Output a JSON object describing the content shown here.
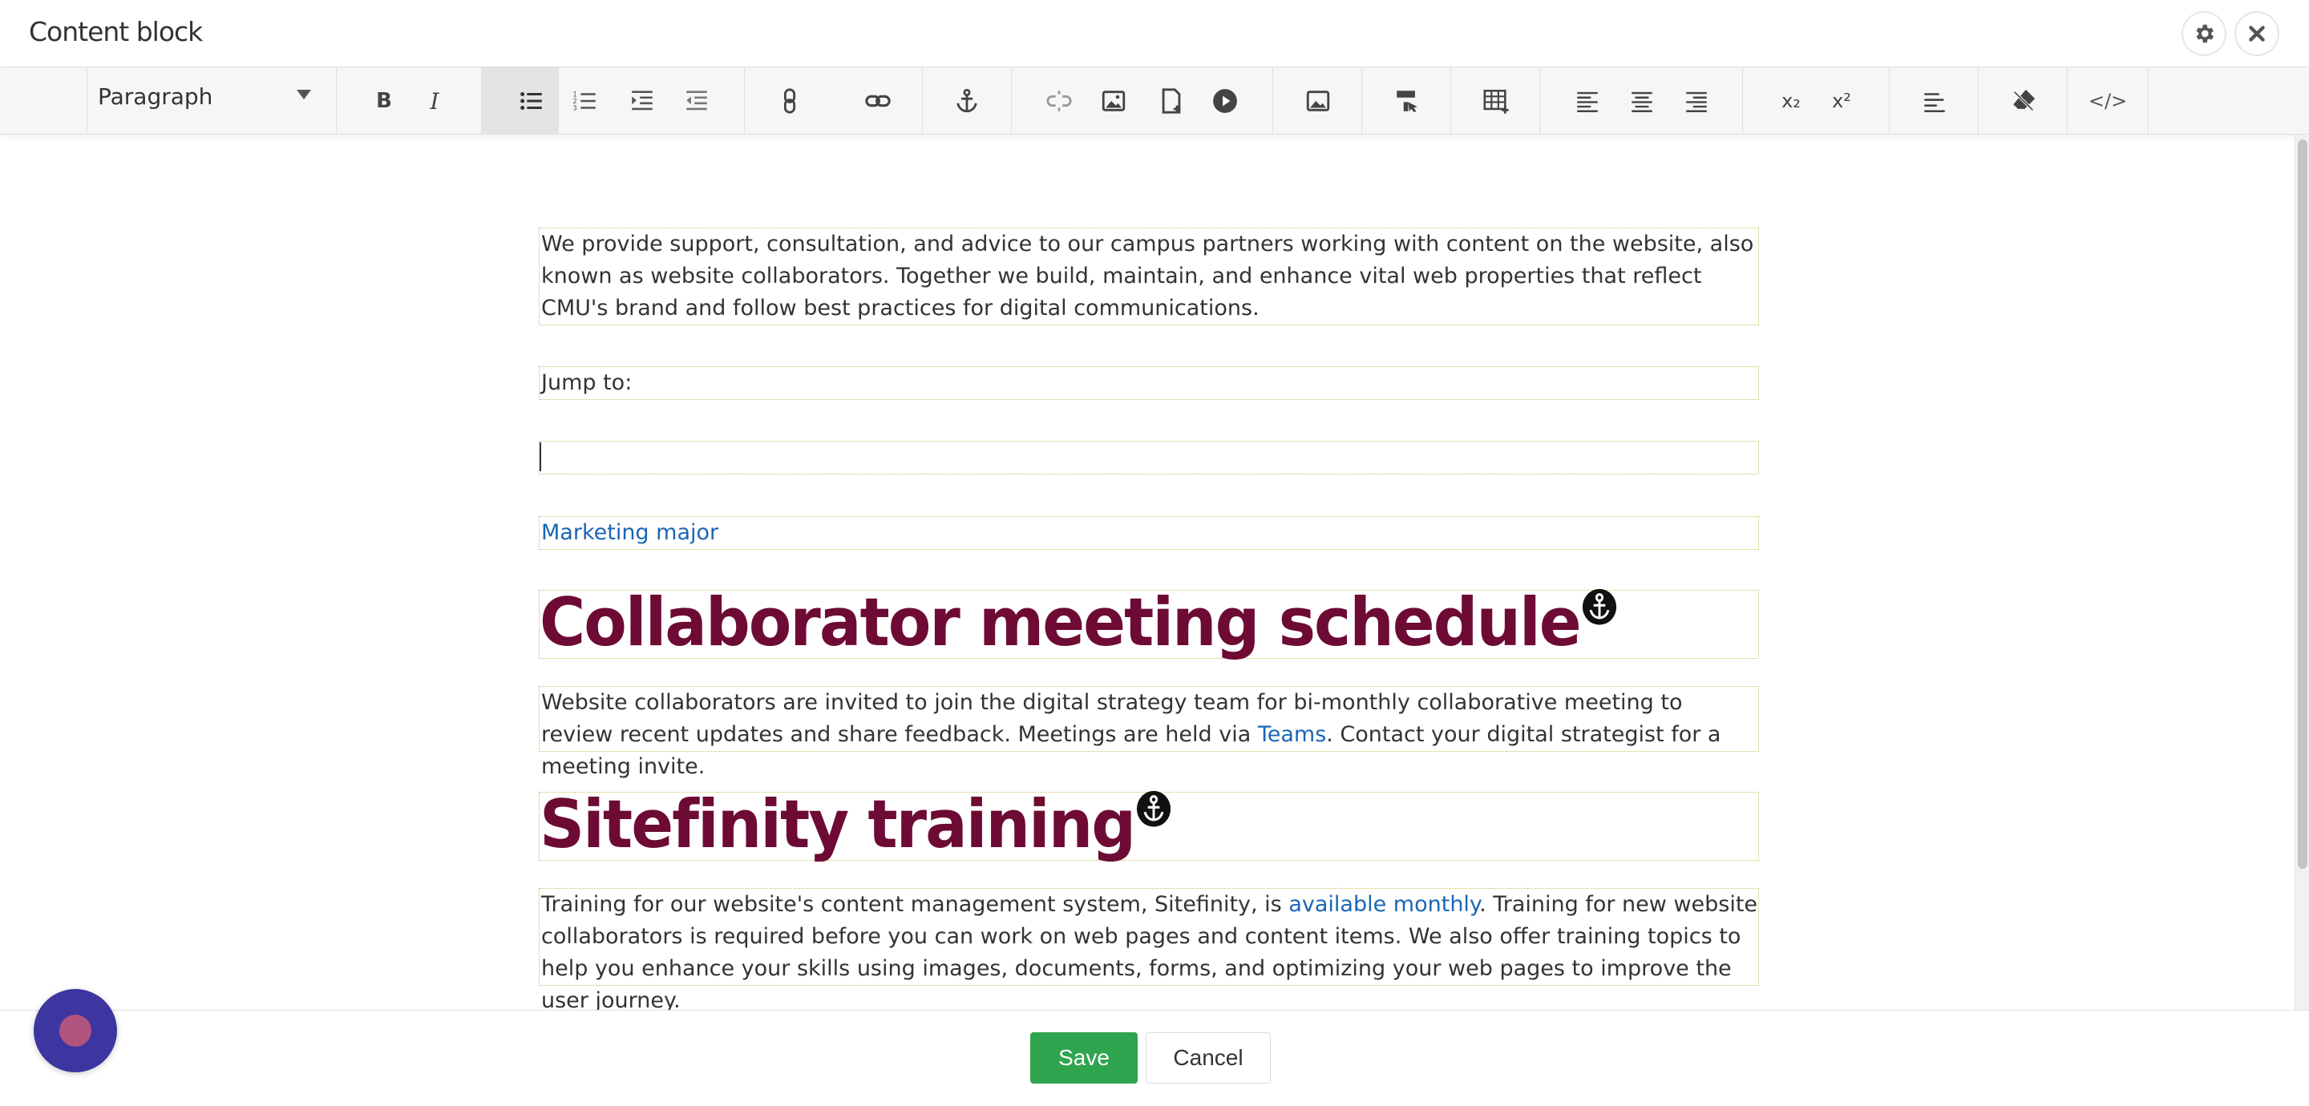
{
  "header": {
    "title": "Content block",
    "settings_icon": "gear-icon",
    "close_icon": "close-icon"
  },
  "toolbar": {
    "format_select": "Paragraph",
    "buttons": [
      {
        "name": "bold",
        "glyph": "B"
      },
      {
        "name": "italic",
        "glyph": "I"
      },
      {
        "name": "bulleted-list"
      },
      {
        "name": "numbered-list"
      },
      {
        "name": "indent"
      },
      {
        "name": "outdent"
      },
      {
        "name": "paragraph-link"
      },
      {
        "name": "link"
      },
      {
        "name": "anchor"
      },
      {
        "name": "unlink"
      },
      {
        "name": "insert-image"
      },
      {
        "name": "insert-document"
      },
      {
        "name": "insert-video"
      },
      {
        "name": "image"
      },
      {
        "name": "format-painter"
      },
      {
        "name": "table"
      },
      {
        "name": "align-left"
      },
      {
        "name": "align-center"
      },
      {
        "name": "align-right"
      },
      {
        "name": "subscript",
        "glyph": "x₂"
      },
      {
        "name": "superscript",
        "glyph": "x²"
      },
      {
        "name": "paragraph-format"
      },
      {
        "name": "clear-formatting"
      },
      {
        "name": "html-view",
        "glyph": "</>"
      }
    ]
  },
  "content": {
    "intro": "We provide support, consultation, and advice to our campus partners working with content on the website, also known as website collaborators. Together we build, maintain, and enhance vital web properties that reflect CMU's brand and follow best practices for digital communications.",
    "jump_to": "Jump to:",
    "marketing_link": "Marketing major",
    "heading1": "Collaborator meeting schedule",
    "para2_before": "Website collaborators are invited to join the digital strategy team for bi-monthly collaborative meeting to review recent updates and share feedback. Meetings are held via ",
    "para2_link": "Teams",
    "para2_after": ". Contact your digital strategist for a meeting invite.",
    "heading2": "Sitefinity training",
    "para3_before": "Training for our website's content management system, Sitefinity, is ",
    "para3_link": "available monthly",
    "para3_after": ". Training for new website collaborators is required before you can work on web pages and content items. We also offer training topics to help you enhance your skills using images, documents, forms, and optimizing your web pages to improve the user journey."
  },
  "footer": {
    "save_label": "Save",
    "cancel_label": "Cancel"
  },
  "colors": {
    "heading": "#6d0b34",
    "link": "#1a66b5",
    "save": "#2ea44f",
    "chat": "#3d35a0"
  }
}
